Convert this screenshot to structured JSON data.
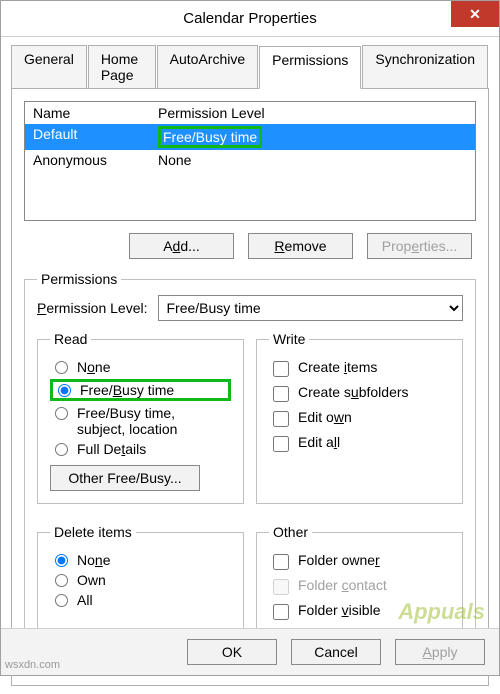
{
  "window": {
    "title": "Calendar Properties",
    "close": "✕"
  },
  "tabs": {
    "general": "General",
    "homepage": "Home Page",
    "autoarchive": "AutoArchive",
    "permissions": "Permissions",
    "sync": "Synchronization",
    "active": "permissions"
  },
  "list": {
    "col_name": "Name",
    "col_level": "Permission Level",
    "rows": [
      {
        "name": "Default",
        "level": "Free/Busy time",
        "selected": true
      },
      {
        "name": "Anonymous",
        "level": "None",
        "selected": false
      }
    ]
  },
  "buttons": {
    "add": "Add...",
    "remove": "Remove",
    "properties": "Properties...",
    "other_freebusy": "Other Free/Busy...",
    "ok": "OK",
    "cancel": "Cancel",
    "apply": "Apply"
  },
  "perm": {
    "group": "Permissions",
    "level_label": "Permission Level:",
    "level_value": "Free/Busy time",
    "read": {
      "legend": "Read",
      "none": "None",
      "freebusy": "Free/Busy time",
      "freebusy_detail": "Free/Busy time, subject, location",
      "full": "Full Details",
      "selected": "freebusy"
    },
    "write": {
      "legend": "Write",
      "create_items": "Create items",
      "create_subfolders": "Create subfolders",
      "edit_own": "Edit own",
      "edit_all": "Edit all"
    },
    "delete": {
      "legend": "Delete items",
      "none": "None",
      "own": "Own",
      "all": "All",
      "selected": "none"
    },
    "other": {
      "legend": "Other",
      "folder_owner": "Folder owner",
      "folder_contact": "Folder contact",
      "folder_visible": "Folder visible"
    }
  },
  "watermark": "Appuals",
  "source": "wsxdn.com"
}
